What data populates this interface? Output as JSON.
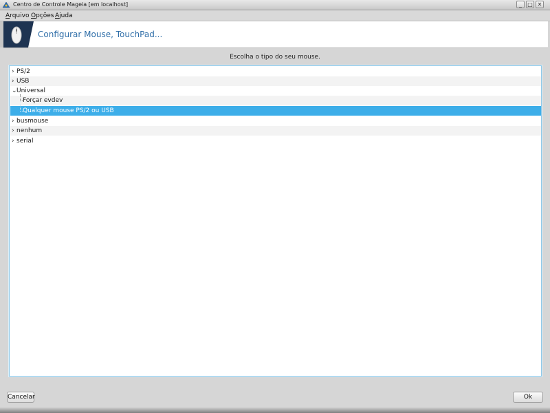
{
  "window": {
    "title": "Centro de Controle Mageia  [em localhost]",
    "buttons": [
      "_",
      "□",
      "✕"
    ]
  },
  "menubar": {
    "items": [
      {
        "label_u": "A",
        "label_rest": "rquivo"
      },
      {
        "label_u": "O",
        "label_rest": "pções"
      },
      {
        "label_u": "A",
        "label_rest": "juda"
      }
    ]
  },
  "header": {
    "title": "Configurar Mouse, TouchPad...",
    "icon": "mouse-icon"
  },
  "content": {
    "prompt": "Escolha o tipo do seu mouse.",
    "tree": [
      {
        "label": "PS/2",
        "expander": "›"
      },
      {
        "label": "USB",
        "expander": "›"
      },
      {
        "label": "Universal",
        "expander": "⌄"
      },
      {
        "label": "Forçar evdev"
      },
      {
        "label": "Qualquer mouse PS/2 ou USB",
        "selected": true
      },
      {
        "label": "busmouse",
        "expander": "›"
      },
      {
        "label": "nenhum",
        "expander": "›"
      },
      {
        "label": "serial",
        "expander": "›"
      }
    ]
  },
  "footer": {
    "cancel_label": "Cancelar",
    "ok_label": "Ok"
  },
  "colors": {
    "selection": "#3daee9",
    "banner_title": "#2f6ea8",
    "banner_icon_bg": "#1e3452"
  }
}
